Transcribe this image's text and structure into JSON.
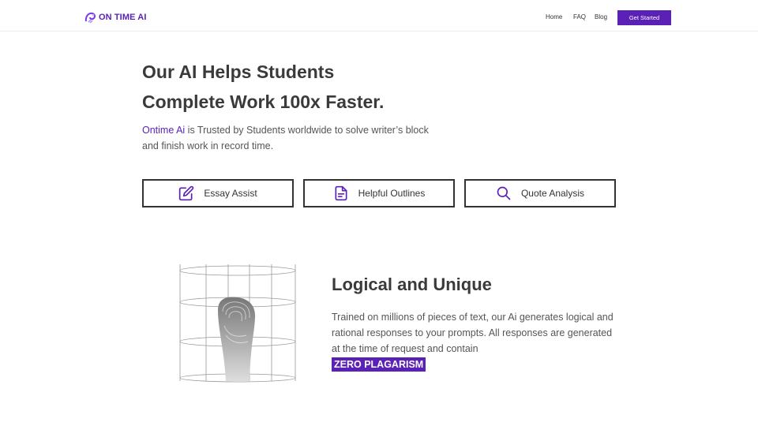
{
  "header": {
    "logo_text": "ON TIME AI",
    "nav": [
      {
        "label": "Home"
      },
      {
        "label": "FAQ"
      },
      {
        "label": "Blog"
      }
    ],
    "cta_label": "Get Started"
  },
  "hero": {
    "title_line1": "Our AI Helps Students",
    "title_line2": "Complete Work 100x Faster.",
    "subtitle_brand": "Ontime Ai",
    "subtitle_rest": " is Trusted by Students worldwide to solve writer’s block and finish work in record time.",
    "features": [
      {
        "label": "Essay Assist",
        "icon": "pencil-square-icon"
      },
      {
        "label": "Helpful Outlines",
        "icon": "document-icon"
      },
      {
        "label": "Quote Analysis",
        "icon": "search-icon"
      }
    ]
  },
  "section": {
    "title": "Logical and Unique",
    "body": "Trained on millions of pieces of text, our Ai generates logical and rational responses to your prompts. All responses are generated at the time of request and contain",
    "highlight": "ZERO PLAGARISM"
  },
  "colors": {
    "accent": "#5b21b6",
    "text": "#3a3a3a"
  }
}
